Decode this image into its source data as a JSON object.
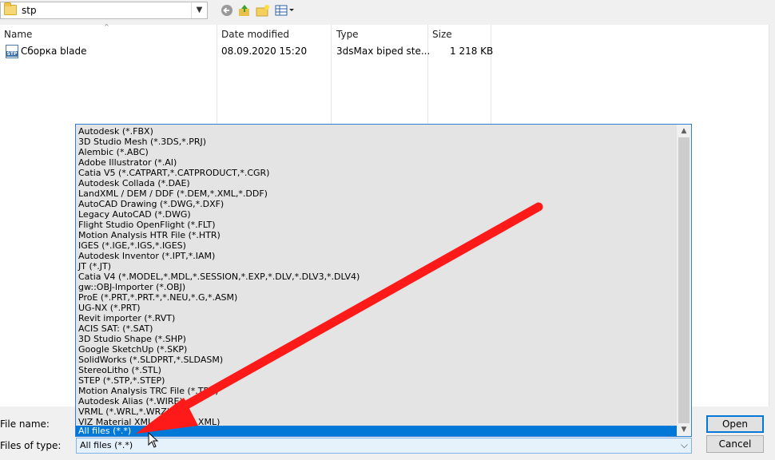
{
  "path": {
    "folder": "stp"
  },
  "columns": {
    "name": "Name",
    "date": "Date modified",
    "type": "Type",
    "size": "Size"
  },
  "file": {
    "name": "Сборка blade",
    "date": "08.09.2020 15:20",
    "type": "3dsMax biped ste...",
    "size": "1 218 KB",
    "icon_label": "STP",
    "icon": "stp-file-icon"
  },
  "filetypes": [
    "Autodesk (*.FBX)",
    "3D Studio Mesh (*.3DS,*.PRJ)",
    "Alembic (*.ABC)",
    "Adobe Illustrator (*.AI)",
    "Catia V5 (*.CATPART,*.CATPRODUCT,*.CGR)",
    "Autodesk Collada (*.DAE)",
    "LandXML / DEM / DDF (*.DEM,*.XML,*.DDF)",
    "AutoCAD Drawing (*.DWG,*.DXF)",
    "Legacy AutoCAD (*.DWG)",
    "Flight Studio OpenFlight (*.FLT)",
    "Motion Analysis HTR File (*.HTR)",
    "IGES (*.IGE,*.IGS,*.IGES)",
    "Autodesk Inventor (*.IPT,*.IAM)",
    "JT (*.JT)",
    "Catia V4 (*.MODEL,*.MDL,*.SESSION,*.EXP,*.DLV,*.DLV3,*.DLV4)",
    "gw::OBJ-Importer (*.OBJ)",
    "ProE (*.PRT,*.PRT.*,*.NEU,*.G,*.ASM)",
    "UG-NX (*.PRT)",
    "Revit importer (*.RVT)",
    "ACIS SAT: (*.SAT)",
    "3D Studio Shape (*.SHP)",
    "Google SketchUp (*.SKP)",
    "SolidWorks (*.SLDPRT,*.SLDASM)",
    "StereoLitho (*.STL)",
    "STEP (*.STP,*.STEP)",
    "Motion Analysis TRC File (*.TRC)",
    "Autodesk Alias (*.WIRE)",
    "VRML (*.WRL,*.WRZ)",
    "VIZ Material XML Import (*.XML)"
  ],
  "selected_filetype": "All files (*.*)",
  "labels": {
    "file_name": "File name:",
    "files_of_type": "Files of type:"
  },
  "buttons": {
    "open": "Open",
    "cancel": "Cancel"
  },
  "colors": {
    "selection": "#0078d7",
    "annotation_arrow": "#ff1a1a"
  }
}
